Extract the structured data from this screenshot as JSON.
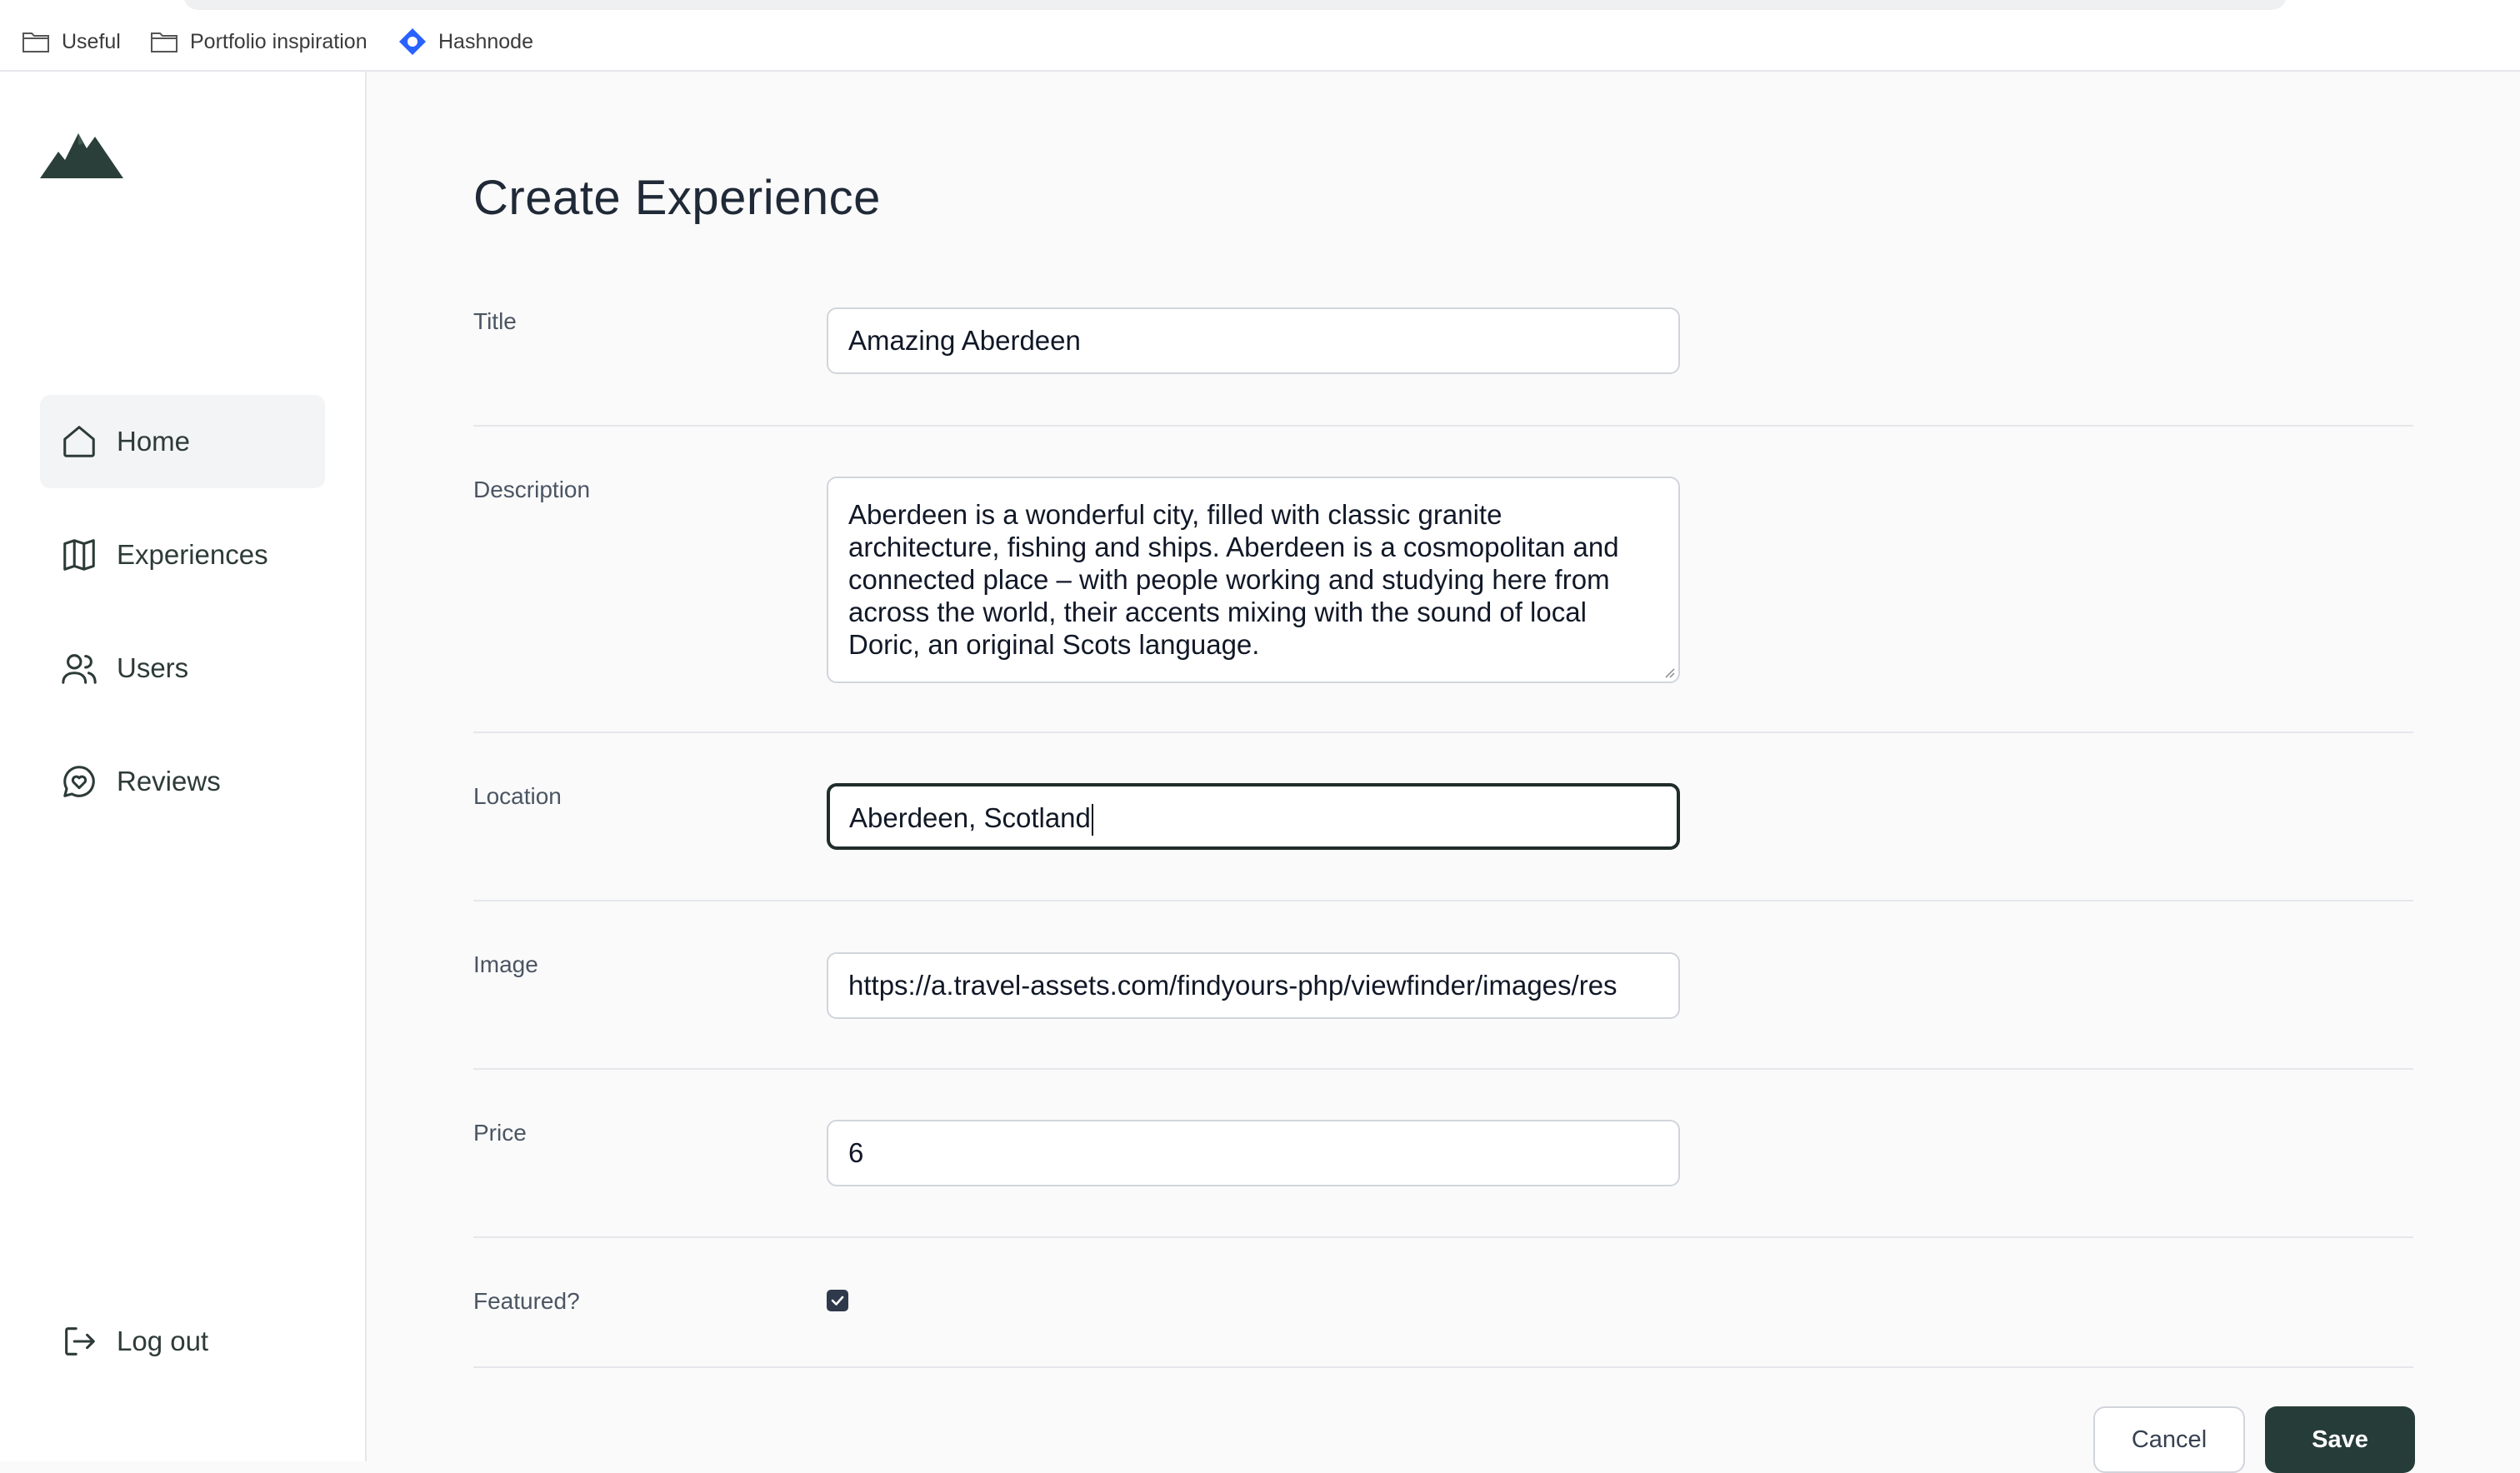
{
  "bookmarks": [
    {
      "label": "Useful",
      "icon": "folder-icon"
    },
    {
      "label": "Portfolio inspiration",
      "icon": "folder-icon"
    },
    {
      "label": "Hashnode",
      "icon": "hashnode-icon"
    }
  ],
  "sidebar": {
    "logo": "mountain-logo",
    "items": [
      {
        "label": "Home",
        "icon": "home-icon",
        "active": true
      },
      {
        "label": "Experiences",
        "icon": "map-icon",
        "active": false
      },
      {
        "label": "Users",
        "icon": "users-icon",
        "active": false
      },
      {
        "label": "Reviews",
        "icon": "chat-heart-icon",
        "active": false
      }
    ],
    "logout": {
      "label": "Log out",
      "icon": "logout-icon"
    }
  },
  "form": {
    "title": "Create Experience",
    "fields": {
      "title": {
        "label": "Title",
        "value": "Amazing Aberdeen"
      },
      "description": {
        "label": "Description",
        "value": "Aberdeen is a wonderful city, filled with classic granite architecture, fishing and ships. Aberdeen is a cosmopolitan and connected place – with people working and studying here from across the world, their accents mixing with the sound of local Doric, an original Scots language."
      },
      "location": {
        "label": "Location",
        "value": "Aberdeen, Scotland"
      },
      "image": {
        "label": "Image",
        "value": "https://a.travel-assets.com/findyours-php/viewfinder/images/res"
      },
      "price": {
        "label": "Price",
        "value": "6"
      },
      "featured": {
        "label": "Featured?",
        "checked": true
      }
    },
    "actions": {
      "cancel": "Cancel",
      "save": "Save"
    }
  },
  "colors": {
    "brand": "#263c38",
    "sidebar_text": "#2d3b38",
    "focus_border": "#1f2d2b",
    "checkbox": "#2e3a4b"
  }
}
